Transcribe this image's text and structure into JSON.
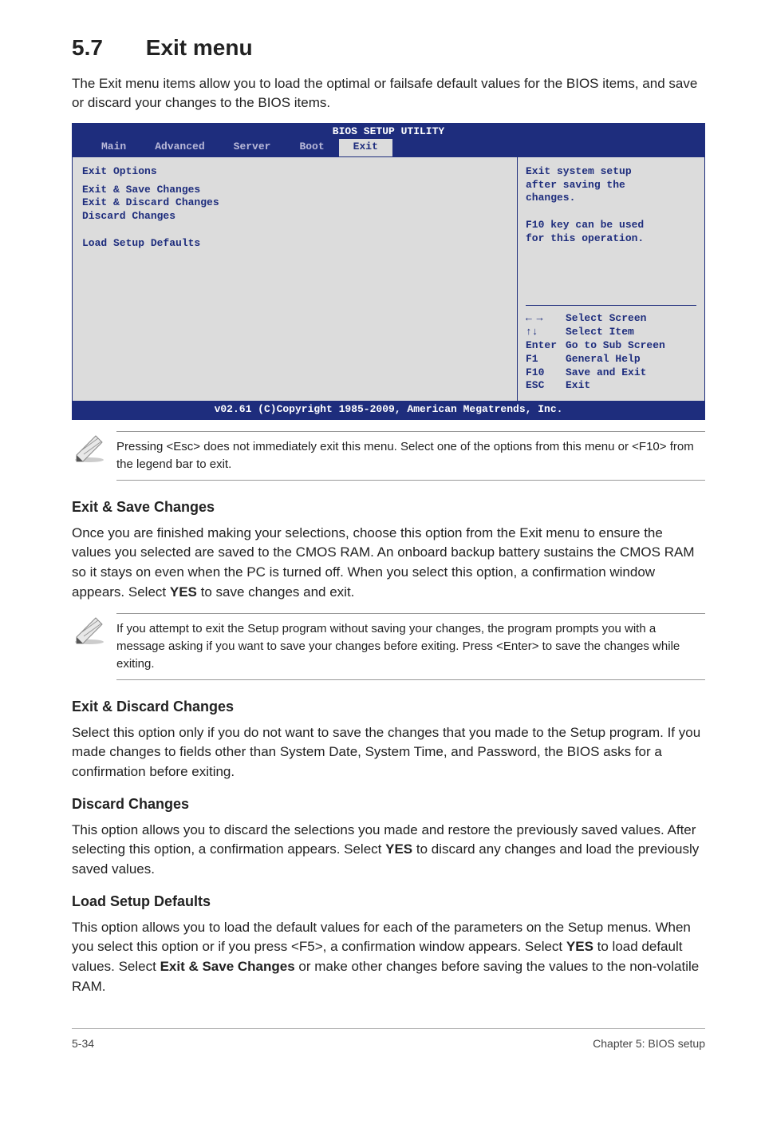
{
  "heading": {
    "number": "5.7",
    "title": "Exit menu"
  },
  "intro": "The Exit menu items allow you to load the optimal or failsafe default values for the BIOS items, and save or discard your changes to the BIOS items.",
  "bios": {
    "title": "BIOS SETUP UTILITY",
    "tabs": [
      "Main",
      "Advanced",
      "Server",
      "Boot",
      "Exit"
    ],
    "active_tab": "Exit",
    "left": {
      "section_title": "Exit Options",
      "items": [
        "Exit & Save Changes",
        "Exit & Discard Changes",
        "Discard Changes",
        "",
        "Load Setup Defaults"
      ]
    },
    "right": {
      "help": [
        "Exit system setup",
        "after saving the",
        "changes.",
        "",
        "F10 key can be used",
        "for this operation."
      ],
      "nav": [
        {
          "key": "←  →",
          "label": "Select Screen"
        },
        {
          "key": "↑↓",
          "label": "Select Item"
        },
        {
          "key": "Enter",
          "label": "Go to Sub Screen"
        },
        {
          "key": "F1",
          "label": "General Help"
        },
        {
          "key": "F10",
          "label": "Save and Exit"
        },
        {
          "key": "ESC",
          "label": "Exit"
        }
      ]
    },
    "footer": "v02.61 (C)Copyright 1985-2009, American Megatrends, Inc."
  },
  "note1": "Pressing <Esc> does not immediately exit this menu. Select one of the options from this menu or <F10> from the legend bar to exit.",
  "sections": {
    "s1": {
      "title": "Exit & Save Changes",
      "body": "Once you are finished making your selections, choose this option from the Exit menu to ensure the values you selected are saved to the CMOS RAM. An onboard backup battery sustains the CMOS RAM so it stays on even when the PC is turned off. When you select this option, a confirmation window appears. Select YES to save changes and exit."
    },
    "s2": {
      "title": "Exit & Discard Changes",
      "body": "Select this option only if you do not want to save the changes that you made to the Setup program. If you made changes to fields other than System Date, System Time, and Password, the BIOS asks for a confirmation before exiting."
    },
    "s3": {
      "title": "Discard Changes",
      "body": "This option allows you to discard the selections you made and restore the previously saved values. After selecting this option, a confirmation appears. Select YES to discard any changes and load the previously saved values."
    },
    "s4": {
      "title": "Load Setup Defaults",
      "body": "This option allows you to load the default values for each of the parameters on the Setup menus. When you select this option or if you press <F5>, a confirmation window appears. Select YES to load default values. Select Exit & Save Changes or make other changes before saving the values to the non-volatile RAM."
    }
  },
  "note2": "If you attempt to exit the Setup program without saving your changes, the program prompts you with a message asking if you want to save your changes before exiting. Press <Enter> to save the changes while exiting.",
  "footer": {
    "left": "5-34",
    "right": "Chapter 5: BIOS setup"
  }
}
